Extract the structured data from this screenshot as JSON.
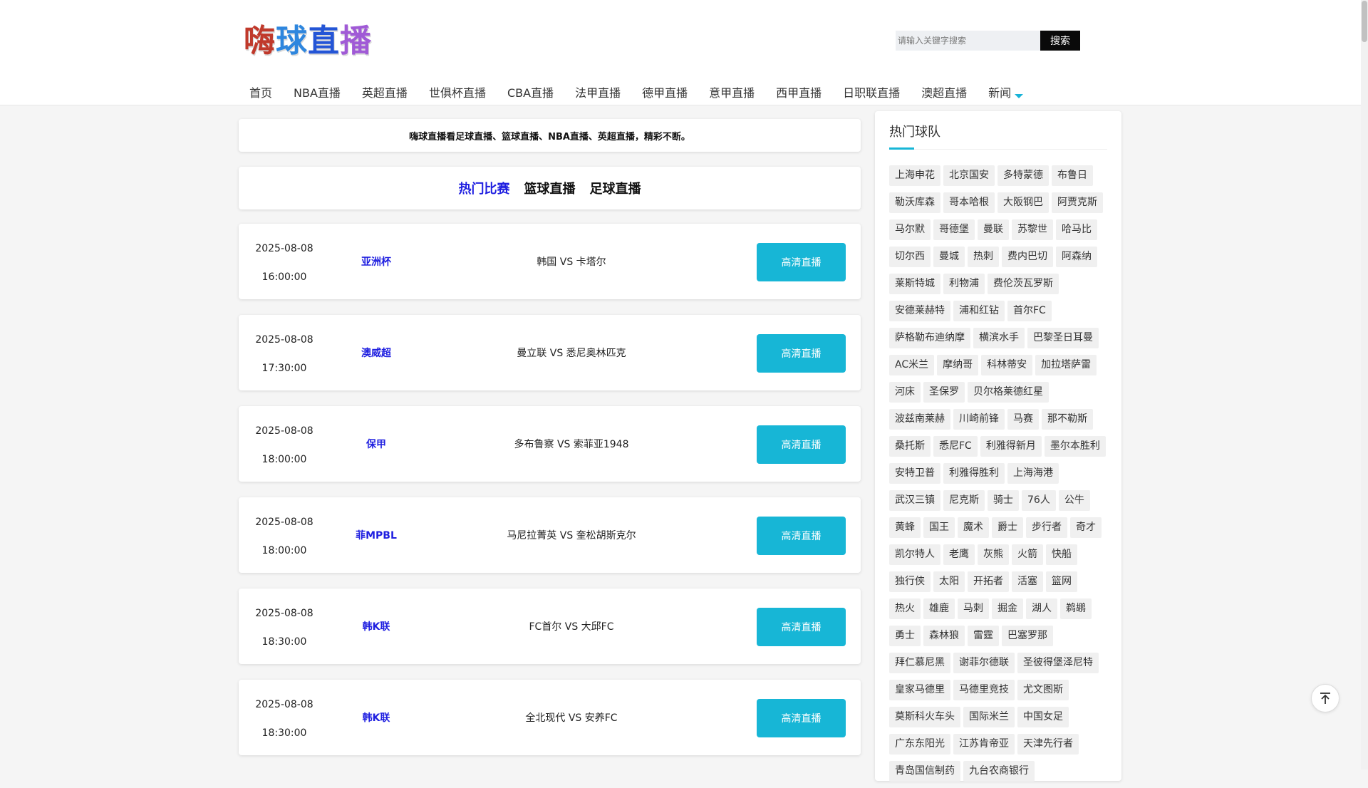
{
  "logo": {
    "chars": [
      {
        "text": "嗨",
        "color": "#c0392b"
      },
      {
        "text": "球",
        "color": "#2e86de"
      },
      {
        "text": "直",
        "color": "#2455d6"
      },
      {
        "text": "播",
        "color": "#a05ad6"
      }
    ]
  },
  "search": {
    "placeholder": "请输入关键字搜索",
    "button": "搜索"
  },
  "nav": {
    "items": [
      "首页",
      "NBA直播",
      "英超直播",
      "世俱杯直播",
      "CBA直播",
      "法甲直播",
      "德甲直播",
      "意甲直播",
      "西甲直播",
      "日职联直播",
      "澳超直播",
      "新闻"
    ]
  },
  "notice": "嗨球直播看足球直播、篮球直播、NBA直播、英超直播，精彩不断。",
  "tabs": [
    "热门比赛",
    "篮球直播",
    "足球直播"
  ],
  "matches": [
    {
      "date": "2025-08-08",
      "time": "16:00:00",
      "league": "亚洲杯",
      "teams": "韩国 VS 卡塔尔",
      "button": "高清直播"
    },
    {
      "date": "2025-08-08",
      "time": "17:30:00",
      "league": "澳威超",
      "teams": "曼立联 VS 悉尼奥林匹克",
      "button": "高清直播"
    },
    {
      "date": "2025-08-08",
      "time": "18:00:00",
      "league": "保甲",
      "teams": "多布鲁察 VS 索菲亚1948",
      "button": "高清直播"
    },
    {
      "date": "2025-08-08",
      "time": "18:00:00",
      "league": "菲MPBL",
      "teams": "马尼拉菁英 VS 奎松胡斯克尔",
      "button": "高清直播"
    },
    {
      "date": "2025-08-08",
      "time": "18:30:00",
      "league": "韩K联",
      "teams": "FC首尔 VS 大邱FC",
      "button": "高清直播"
    },
    {
      "date": "2025-08-08",
      "time": "18:30:00",
      "league": "韩K联",
      "teams": "全北现代 VS 安养FC",
      "button": "高清直播"
    }
  ],
  "sidebar": {
    "title": "热门球队",
    "teams": [
      "上海申花",
      "北京国安",
      "多特蒙德",
      "布鲁日",
      "勒沃库森",
      "哥本哈根",
      "大阪钢巴",
      "阿贾克斯",
      "马尔默",
      "哥德堡",
      "曼联",
      "苏黎世",
      "哈马比",
      "切尔西",
      "曼城",
      "热刺",
      "费内巴切",
      "阿森纳",
      "莱斯特城",
      "利物浦",
      "费伦茨瓦罗斯",
      "安德莱赫特",
      "浦和红钻",
      "首尔FC",
      "萨格勒布迪纳摩",
      "横滨水手",
      "巴黎圣日耳曼",
      "AC米兰",
      "摩纳哥",
      "科林蒂安",
      "加拉塔萨雷",
      "河床",
      "圣保罗",
      "贝尔格莱德红星",
      "波兹南莱赫",
      "川崎前锋",
      "马赛",
      "那不勒斯",
      "桑托斯",
      "悉尼FC",
      "利雅得新月",
      "墨尔本胜利",
      "安特卫普",
      "利雅得胜利",
      "上海海港",
      "武汉三镇",
      "尼克斯",
      "骑士",
      "76人",
      "公牛",
      "黄蜂",
      "国王",
      "魔术",
      "爵士",
      "步行者",
      "奇才",
      "凯尔特人",
      "老鹰",
      "灰熊",
      "火箭",
      "快船",
      "独行侠",
      "太阳",
      "开拓者",
      "活塞",
      "篮网",
      "热火",
      "雄鹿",
      "马刺",
      "掘金",
      "湖人",
      "鹈鹕",
      "勇士",
      "森林狼",
      "雷霆",
      "巴塞罗那",
      "拜仁慕尼黑",
      "谢菲尔德联",
      "圣彼得堡泽尼特",
      "皇家马德里",
      "马德里竞技",
      "尤文图斯",
      "莫斯科火车头",
      "国际米兰",
      "中国女足",
      "广东东阳光",
      "江苏肯帝亚",
      "天津先行者",
      "青岛国信制药",
      "九台农商银行"
    ]
  },
  "colors": {
    "accent": "#17b6d6",
    "link": "#1f1fe0"
  }
}
